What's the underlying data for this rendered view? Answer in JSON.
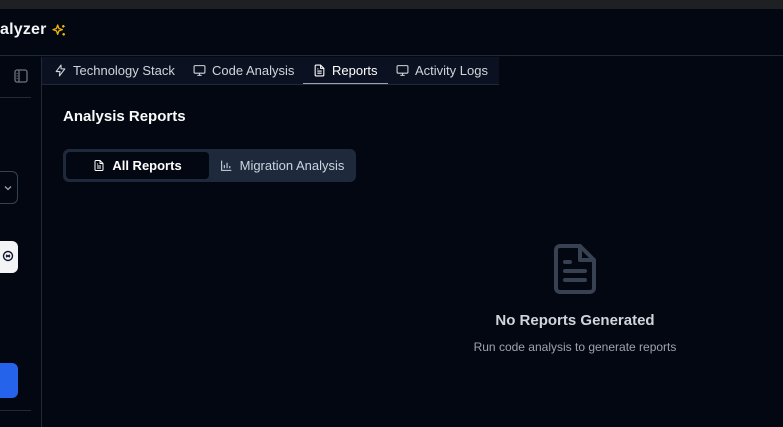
{
  "header": {
    "app_title": "alyzer",
    "sparkle_icon": "sparkles-icon",
    "sparkle_color": "#eab308"
  },
  "tabs": [
    {
      "label": "Technology Stack",
      "icon": "zap-icon"
    },
    {
      "label": "Code Analysis",
      "icon": "monitor-icon"
    },
    {
      "label": "Reports",
      "icon": "file-text-icon",
      "active": true
    },
    {
      "label": "Activity Logs",
      "icon": "monitor-icon"
    }
  ],
  "reports": {
    "title": "Analysis Reports",
    "segments": [
      {
        "label": "All Reports",
        "icon": "file-text-icon",
        "active": true
      },
      {
        "label": "Migration Analysis",
        "icon": "bar-chart-icon"
      }
    ],
    "empty_state": {
      "icon": "file-text-icon",
      "title": "No Reports Generated",
      "subtitle": "Run code analysis to generate reports"
    }
  },
  "colors": {
    "background": "#030712",
    "accent_blue": "#2563eb",
    "border": "#1f2937"
  }
}
